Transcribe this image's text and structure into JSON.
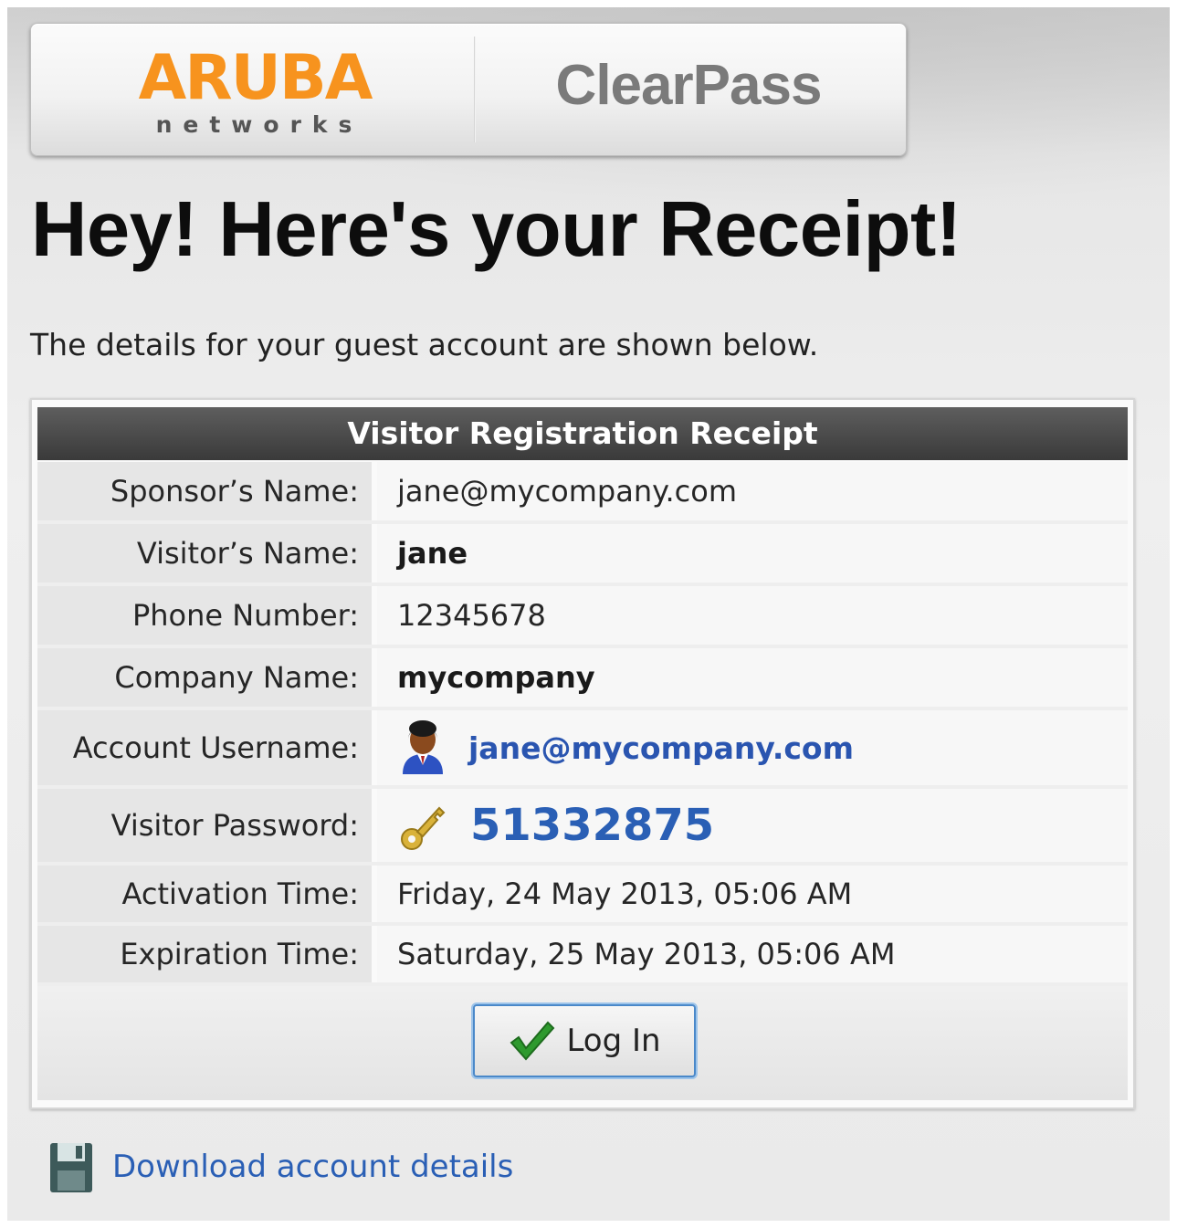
{
  "banner": {
    "brand_name": "ARUBA",
    "brand_sub": "networks",
    "product": "ClearPass"
  },
  "page": {
    "title": "Hey! Here's your Receipt!",
    "intro": "The details for your guest account are shown below."
  },
  "receipt": {
    "header": "Visitor Registration Receipt",
    "rows": [
      {
        "label": "Sponsor’s Name:",
        "value": "jane@mycompany.com"
      },
      {
        "label": "Visitor’s Name:",
        "value": "jane"
      },
      {
        "label": "Phone Number:",
        "value": "12345678"
      },
      {
        "label": "Company Name:",
        "value": "mycompany"
      },
      {
        "label": "Account Username:",
        "value": "jane@mycompany.com",
        "icon": "user-icon"
      },
      {
        "label": "Visitor Password:",
        "value": "51332875",
        "icon": "key-icon"
      },
      {
        "label": "Activation Time:",
        "value": "Friday, 24 May 2013, 05:06 AM"
      },
      {
        "label": "Expiration Time:",
        "value": "Saturday, 25 May 2013, 05:06 AM"
      }
    ],
    "login_button": {
      "label": "Log In",
      "icon": "checkmark-icon"
    }
  },
  "download": {
    "label": "Download account details",
    "icon": "floppy-disk-icon"
  },
  "colors": {
    "brand_orange": "#f7931e",
    "link_blue": "#2a5fb5",
    "header_dark": "#3a3a3a"
  }
}
